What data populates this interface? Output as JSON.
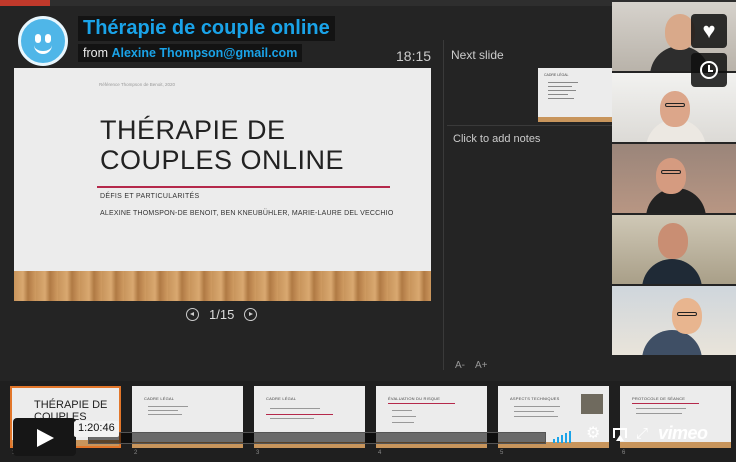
{
  "video": {
    "title": "Thérapie de couple online",
    "from_label": "from",
    "author": "Alexine Thompson@gmail.com",
    "progress_fraction": 0.0
  },
  "presenter": {
    "timer": "18:15",
    "next_slide_label": "Next slide",
    "notes_placeholder": "Click to add notes",
    "slide_counter": "1/15",
    "font_decrease": "A-",
    "font_increase": "A+"
  },
  "current_slide": {
    "header": "Référence Thompson de Benoit, 2020",
    "title_line1": "THÉRAPIE DE",
    "title_line2": "COUPLES ONLINE",
    "subtitle": "DÉFIS ET PARTICULARITÉS",
    "authors": "ALEXINE THOMSPON-DE BENOIT, BEN KNEUBÜHLER, MARIE-LAURE DEL VECCHIO"
  },
  "next_slide_thumb": {
    "title": "CADRE LÉGAL"
  },
  "thumbnails": [
    {
      "num": "1",
      "title": "THÉRAPIE DE COUPLES ONLINE",
      "active": true
    },
    {
      "num": "2",
      "title": "CADRE LÉGAL"
    },
    {
      "num": "3",
      "title": "CADRE LÉGAL"
    },
    {
      "num": "4",
      "title": "ÉVALUATION DU RISQUE"
    },
    {
      "num": "5",
      "title": "ASPECTS TECHNIQUES"
    },
    {
      "num": "6",
      "title": "PROTOCOLE DE SÉANCE"
    }
  ],
  "controls": {
    "current_time": "1:20:46",
    "logo": "vimeo",
    "icons": [
      "play-icon",
      "volume-icon",
      "settings-icon",
      "airplay-icon",
      "fullscreen-icon"
    ]
  },
  "side_buttons": [
    "heart-icon",
    "clock-icon"
  ],
  "colors": {
    "accent": "#1aa3e8",
    "slide_rule": "#b5294b",
    "active_thumb": "#e2762a"
  }
}
